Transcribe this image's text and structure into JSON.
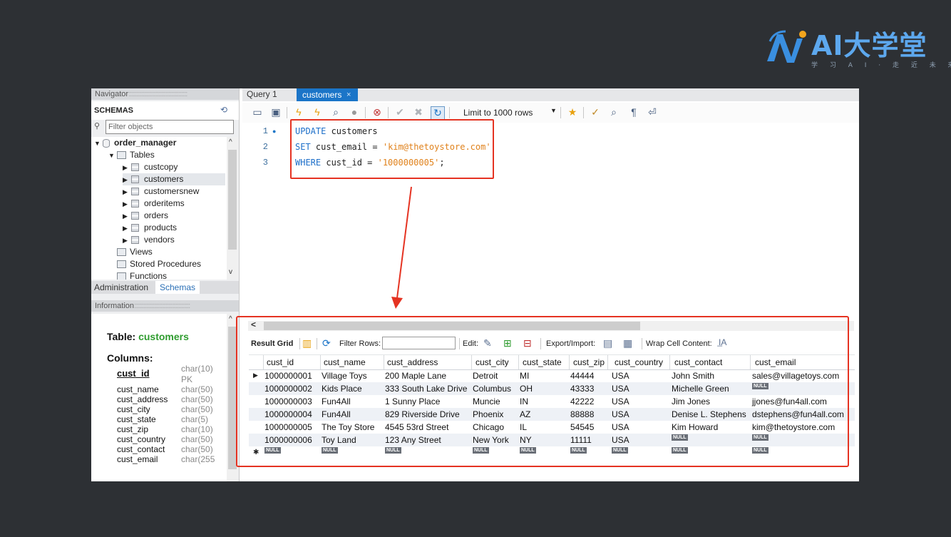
{
  "logo": {
    "text": "AI大学堂",
    "subtitle": "学 习 A I · 走 近 未 来"
  },
  "navigator": {
    "title": "Navigator",
    "schemas_label": "SCHEMAS",
    "filter_placeholder": "Filter objects",
    "database": "order_manager",
    "tables_folder": "Tables",
    "tables": [
      "custcopy",
      "customers",
      "customersnew",
      "orderitems",
      "orders",
      "products",
      "vendors"
    ],
    "selected_table": "customers",
    "folders": [
      "Views",
      "Stored Procedures",
      "Functions"
    ],
    "tab_admin": "Administration",
    "tab_schemas": "Schemas"
  },
  "information": {
    "title": "Information",
    "table_label": "Table:",
    "table_name": "customers",
    "columns_label": "Columns:",
    "columns": [
      {
        "name": "cust_id",
        "type": "char(10)",
        "extra": "PK"
      },
      {
        "name": "cust_name",
        "type": "char(50)"
      },
      {
        "name": "cust_address",
        "type": "char(50)"
      },
      {
        "name": "cust_city",
        "type": "char(50)"
      },
      {
        "name": "cust_state",
        "type": "char(5)"
      },
      {
        "name": "cust_zip",
        "type": "char(10)"
      },
      {
        "name": "cust_country",
        "type": "char(50)"
      },
      {
        "name": "cust_contact",
        "type": "char(50)"
      },
      {
        "name": "cust_email",
        "type": "char(255"
      }
    ]
  },
  "tabs": {
    "query": "Query 1",
    "active": "customers",
    "close": "×"
  },
  "toolbar": {
    "limit": "Limit to 1000 rows"
  },
  "sql": {
    "line_numbers": [
      "1",
      "2",
      "3"
    ],
    "lines": [
      {
        "kw": "UPDATE",
        "rest": " customers",
        "str": "",
        "tail": ""
      },
      {
        "kw": "SET",
        "rest": " cust_email = ",
        "str": "'kim@thetoystore.com'",
        "tail": ""
      },
      {
        "kw": "WHERE",
        "rest": " cust_id = ",
        "str": "'1000000005'",
        "tail": ";"
      }
    ]
  },
  "result_toolbar": {
    "result_grid": "Result Grid",
    "filter_rows": "Filter Rows:",
    "edit": "Edit:",
    "export_import": "Export/Import:",
    "wrap": "Wrap Cell Content:"
  },
  "grid": {
    "null_text": "NULL",
    "columns": [
      "cust_id",
      "cust_name",
      "cust_address",
      "cust_city",
      "cust_state",
      "cust_zip",
      "cust_country",
      "cust_contact",
      "cust_email"
    ],
    "rows": [
      [
        "1000000001",
        "Village Toys",
        "200 Maple Lane",
        "Detroit",
        "MI",
        "44444",
        "USA",
        "John Smith",
        "sales@villagetoys.com"
      ],
      [
        "1000000002",
        "Kids Place",
        "333 South Lake Drive",
        "Columbus",
        "OH",
        "43333",
        "USA",
        "Michelle Green",
        null
      ],
      [
        "1000000003",
        "Fun4All",
        "1 Sunny Place",
        "Muncie",
        "IN",
        "42222",
        "USA",
        "Jim Jones",
        "jjones@fun4all.com"
      ],
      [
        "1000000004",
        "Fun4All",
        "829 Riverside Drive",
        "Phoenix",
        "AZ",
        "88888",
        "USA",
        "Denise L. Stephens",
        "dstephens@fun4all.com"
      ],
      [
        "1000000005",
        "The Toy Store",
        "4545 53rd Street",
        "Chicago",
        "IL",
        "54545",
        "USA",
        "Kim Howard",
        "kim@thetoystore.com"
      ],
      [
        "1000000006",
        "Toy Land",
        "123 Any Street",
        "New York",
        "NY",
        "11111",
        "USA",
        null,
        null
      ]
    ]
  },
  "colors": {
    "accent_red": "#e53322",
    "tab_blue": "#1b75c8",
    "sql_keyword": "#1d6fc9",
    "sql_string": "#e0821c",
    "table_name_green": "#2f9c2f"
  }
}
